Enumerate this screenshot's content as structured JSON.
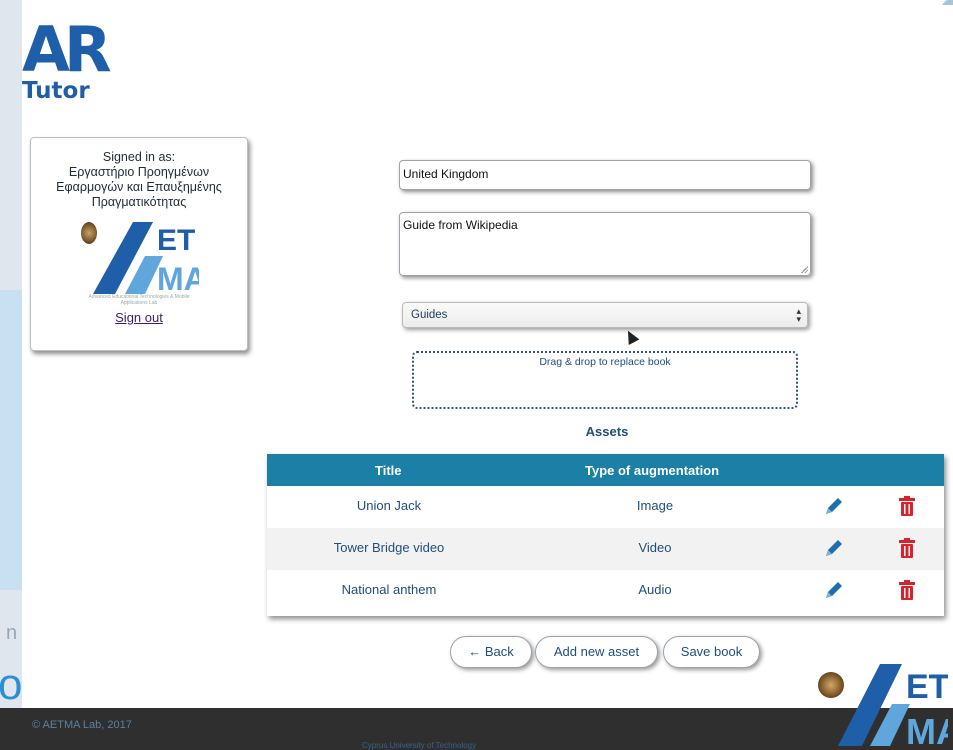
{
  "app": {
    "logo_main": "AR",
    "logo_sub": "Tutor"
  },
  "user": {
    "signed_in_label": "Signed in as:",
    "organization": "Εργαστήριο Προηγμένων Εφαρμογών και Επαυξημένης Πραγματικότητας",
    "org_logo_text": "ET MA",
    "org_logo_caption": "Advanced Educational Technologies & Mobile Applications Lab",
    "sign_out_label": "Sign out"
  },
  "book": {
    "title_value": "United Kingdom",
    "description_value": "Guide from Wikipedia",
    "category_selected": "Guides",
    "dropzone_text": "Drag & drop to replace book"
  },
  "assets": {
    "heading": "Assets",
    "columns": [
      "Title",
      "Type of augmentation"
    ],
    "rows": [
      {
        "title": "Union Jack",
        "type": "Image"
      },
      {
        "title": "Tower Bridge video",
        "type": "Video"
      },
      {
        "title": "National anthem",
        "type": "Audio"
      }
    ]
  },
  "actions": {
    "back_label": "← Back",
    "add_asset_label": "Add new asset",
    "save_label": "Save book"
  },
  "footer": {
    "copyright": "© AETMA Lab, 2017",
    "department": "Cyprus University of Technology"
  },
  "colors": {
    "brand_blue": "#1f5ea8",
    "table_header": "#1b7fa6",
    "delete_red": "#d9232c",
    "edit_blue": "#1f6fb0"
  },
  "icons": [
    "pencil-icon",
    "trash-icon",
    "select-arrows-icon",
    "cursor-icon"
  ]
}
